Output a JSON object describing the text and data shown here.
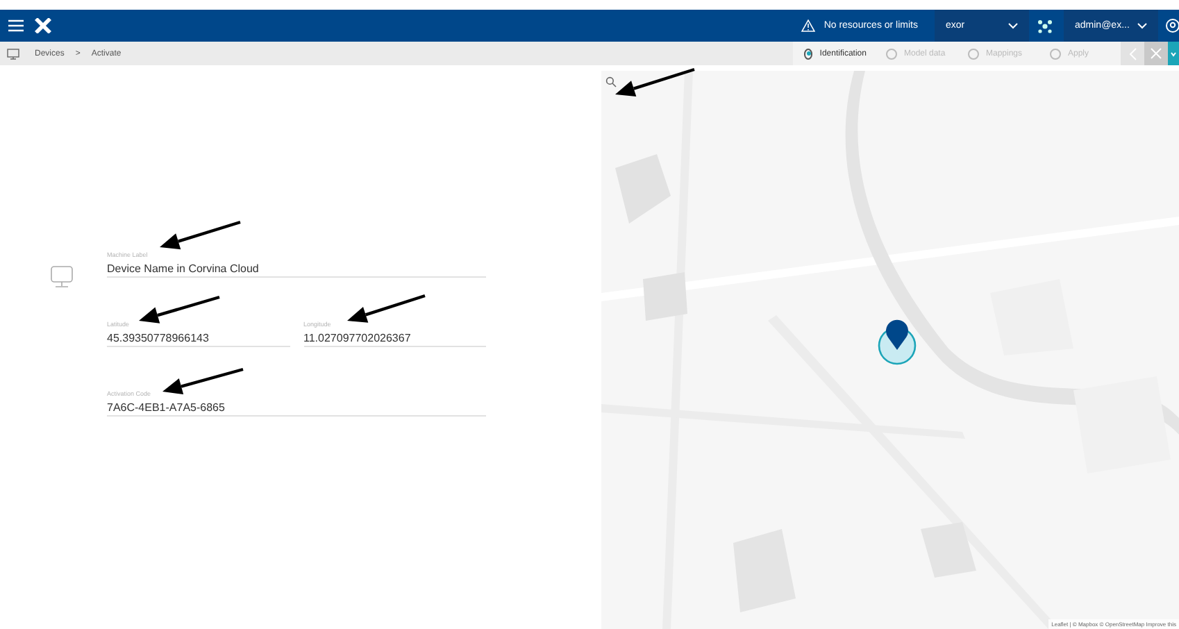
{
  "header": {
    "notice": "No resources or limits",
    "organization": "exor",
    "user": "admin@ex..."
  },
  "breadcrumb": {
    "items": [
      "Devices",
      "Activate"
    ],
    "separator": ">"
  },
  "steps": [
    {
      "label": "Identification",
      "selected": true
    },
    {
      "label": "Model data",
      "selected": false
    },
    {
      "label": "Mappings",
      "selected": false
    },
    {
      "label": "Apply",
      "selected": false
    }
  ],
  "form": {
    "rows": [
      [
        {
          "label": "Machine Label",
          "value": "Device Name in Corvina Cloud"
        }
      ],
      [
        {
          "label": "Latitude",
          "value": "45.39350778966143"
        },
        {
          "label": "Longitude",
          "value": "11.027097702026367"
        }
      ],
      [
        {
          "label": "Activation Code",
          "value": "7A6C-4EB1-A7A5-6865"
        }
      ]
    ]
  },
  "map": {
    "attribution": "Leaflet | © Mapbox © OpenStreetMap Improve this"
  }
}
